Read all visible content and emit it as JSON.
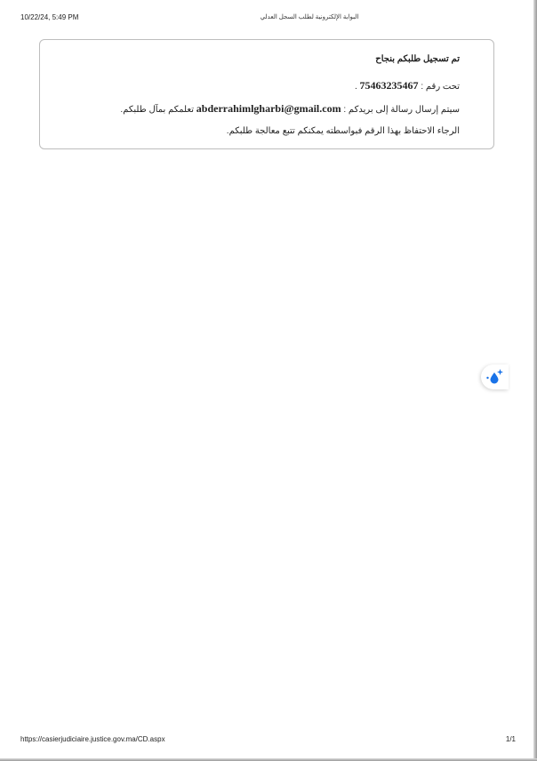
{
  "print_header": {
    "date": "10/22/24, 5:49 PM",
    "title": "البوابة الإلكترونية لطلب السجل العدلي"
  },
  "card": {
    "title": "تم تسجيل طلبكم بنجاح",
    "line1_prefix": "تحت رقم :",
    "request_number": "75463235467",
    "line1_suffix": ".",
    "line2_prefix": "سيتم إرسال رسالة إلى بريدكم :",
    "email": "abderrahimlgharbi@gmail.com",
    "line2_suffix": "تعلمكم بمآل طلبكم.",
    "line3": "الرجاء الاحتفاظ بهذا الرقم فبواسطته يمكنكم تتبع معالجة طلبكم."
  },
  "floating_widget": {
    "icon": "sparkle-drop-icon",
    "color": "#1a73e8"
  },
  "print_footer": {
    "url": "https://casierjudiciaire.justice.gov.ma/CD.aspx",
    "page": "1/1"
  }
}
